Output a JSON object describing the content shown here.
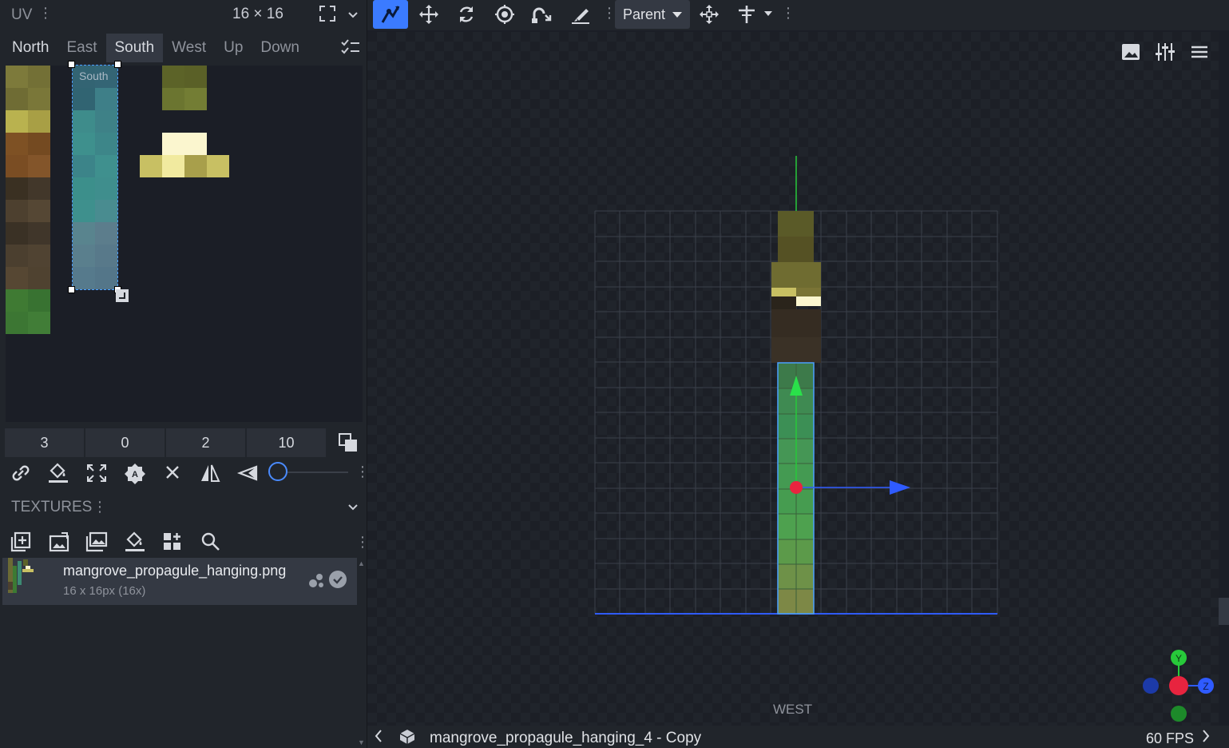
{
  "uv_panel": {
    "title": "UV",
    "resolution": "16 × 16",
    "faces": [
      "North",
      "East",
      "South",
      "West",
      "Up",
      "Down"
    ],
    "selected_face": "South",
    "selection_label": "South",
    "fields": [
      "3",
      "0",
      "2",
      "10"
    ]
  },
  "textures_panel": {
    "title": "TEXTURES",
    "texture": {
      "name": "mangrove_propagule_hanging.png",
      "resolution": "16 x 16px (16x)"
    }
  },
  "toolbar": {
    "transform_space": "Parent"
  },
  "viewport": {
    "view_label": "WEST"
  },
  "status_bar": {
    "element_name": "mangrove_propagule_hanging_4 - Copy",
    "fps": "60 FPS"
  },
  "colors": {
    "accent": "#3b7bff",
    "panel": "#21252b",
    "selected_tab": "#343943",
    "grid_line": "#3a3f4a",
    "axis_x": "#2f5bff",
    "axis_y": "#27c93a"
  }
}
